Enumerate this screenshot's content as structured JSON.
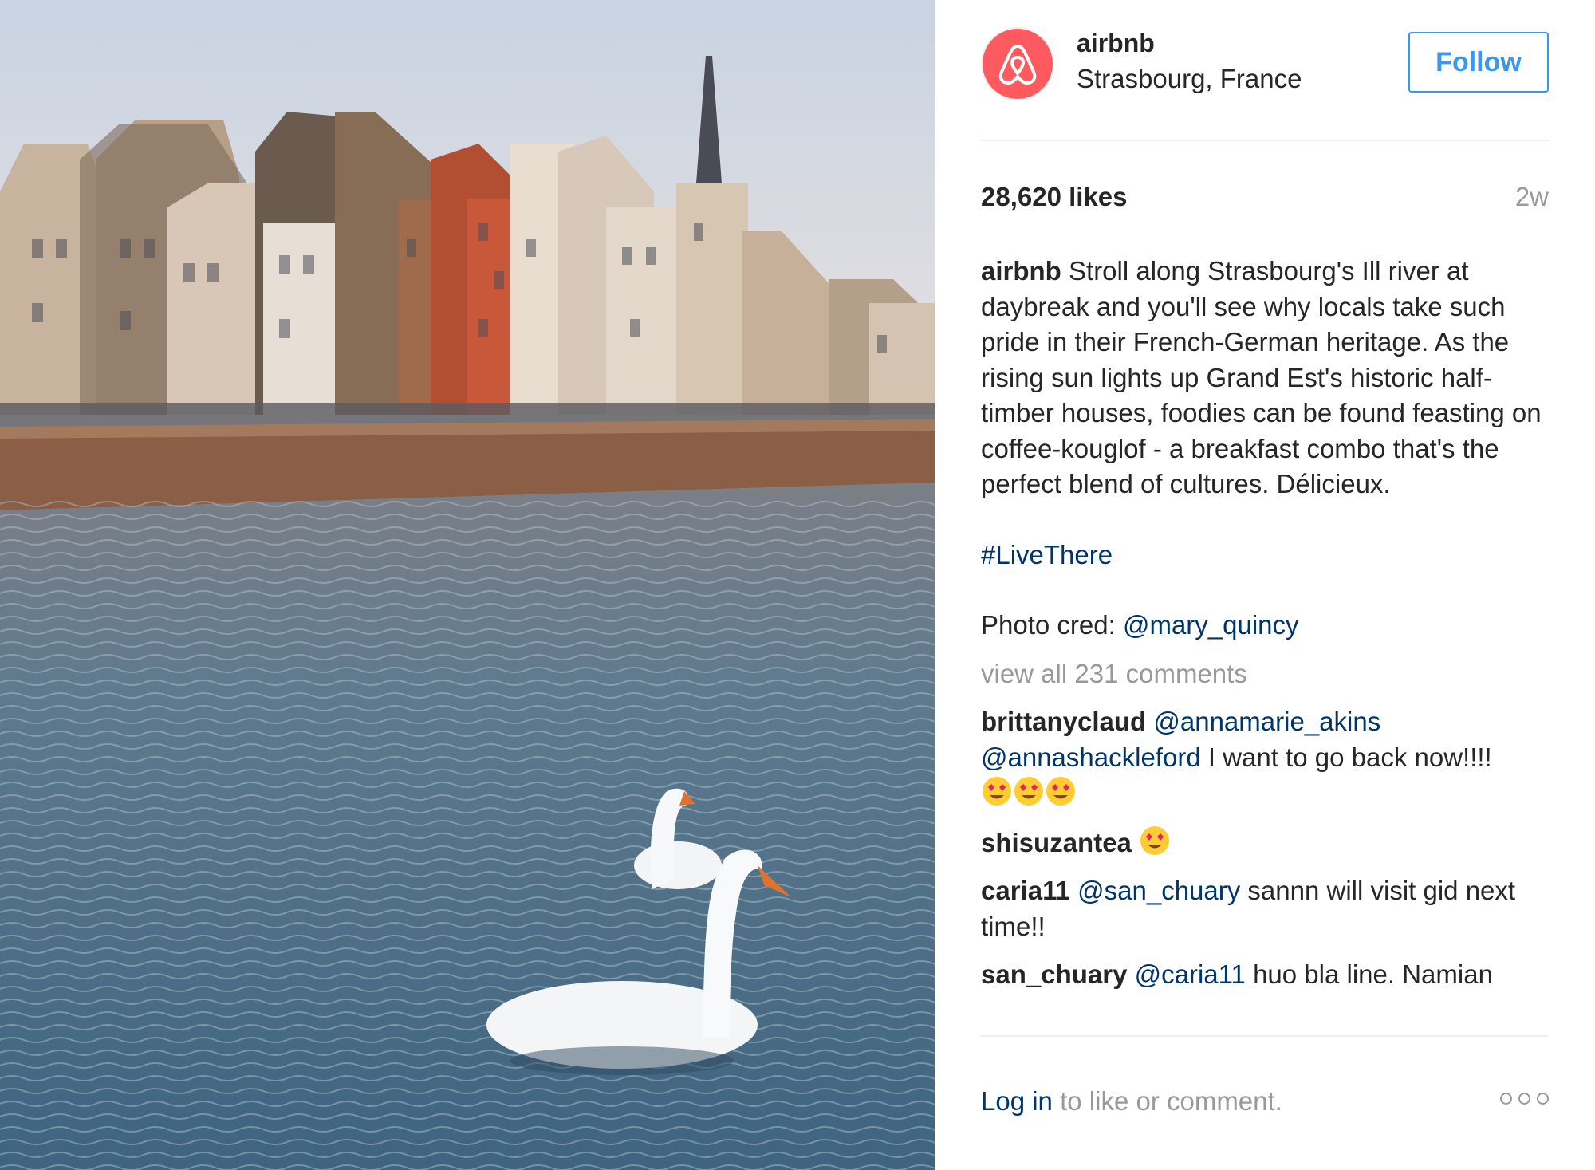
{
  "post": {
    "username": "airbnb",
    "location": "Strasbourg, France",
    "follow_label": "Follow",
    "likes": "28,620 likes",
    "age": "2w",
    "caption": {
      "username": "airbnb",
      "text": "Stroll along Strasbourg's Ill river at daybreak and you'll see why locals take such pride in their French-German heritage. As the rising sun lights up Grand Est's historic half-timber houses, foodies can be found feasting on coffee-kouglof - a breakfast combo that's the perfect blend of cultures. Délicieux.",
      "hashtag": "#LiveThere",
      "credit_prefix": "Photo cred:",
      "credit_mention": "@mary_quincy"
    },
    "view_all": "view all 231 comments",
    "comments": [
      {
        "username": "brittanyclaud",
        "mention1": "@annamarie_akins",
        "mention2": "@annashackleford",
        "text": "I want to go back now!!!!"
      },
      {
        "username": "shisuzantea"
      },
      {
        "username": "caria11",
        "mention": "@san_chuary",
        "text": "sannn will visit gid next time!!"
      },
      {
        "username": "san_chuary",
        "mention": "@caria11",
        "text": "huo bla line. Namian"
      }
    ],
    "footer": {
      "login": "Log in",
      "rest": "to like or comment."
    },
    "icons": {
      "avatar": "airbnb-logo-icon",
      "more": "more-options-icon",
      "emoji": "heart-eyes-emoji-icon"
    },
    "colors": {
      "brand": "#ff5a5f",
      "follow": "#3897f0",
      "link": "#003569"
    }
  }
}
